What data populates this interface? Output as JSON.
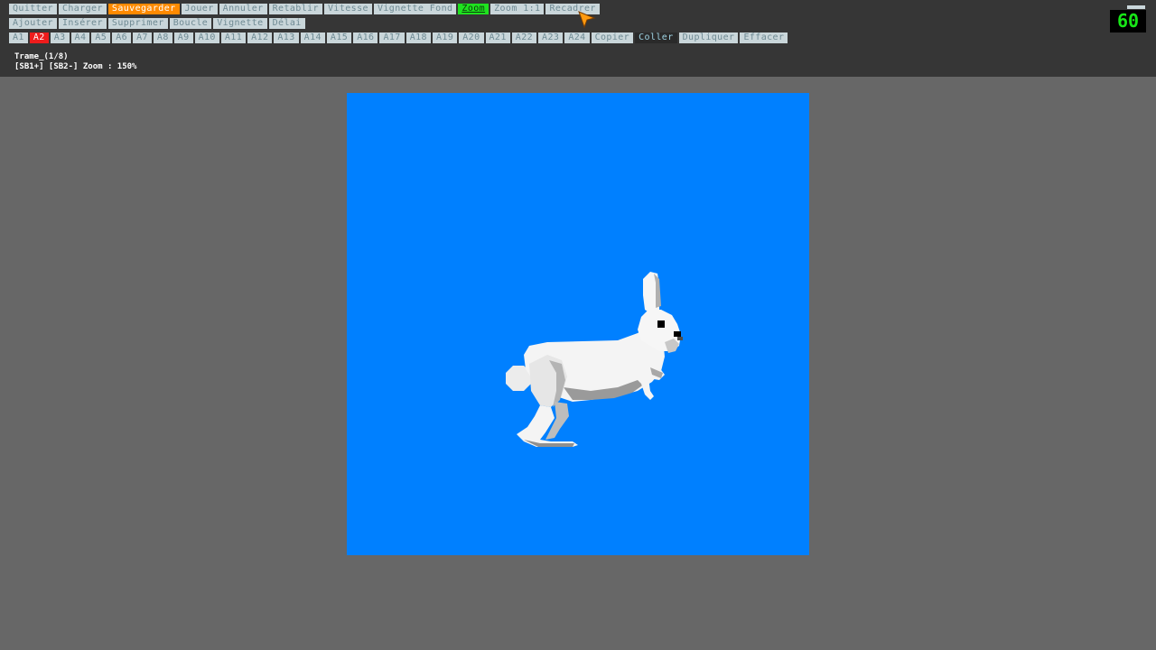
{
  "toolbar": {
    "menu": [
      {
        "label": "Quitter",
        "state": "normal"
      },
      {
        "label": "Charger",
        "state": "normal"
      },
      {
        "label": "Sauvegarder",
        "state": "active"
      },
      {
        "label": "Jouer",
        "state": "normal"
      },
      {
        "label": "Annuler",
        "state": "normal"
      },
      {
        "label": "Retablir",
        "state": "normal"
      },
      {
        "label": "Vitesse",
        "state": "normal"
      },
      {
        "label": "Vignette Fond",
        "state": "normal"
      },
      {
        "label": "Zoom",
        "state": "highlighted"
      },
      {
        "label": "Zoom 1:1",
        "state": "normal"
      },
      {
        "label": "Recadrer",
        "state": "normal"
      }
    ],
    "frame_actions": [
      {
        "label": "Ajouter"
      },
      {
        "label": "Insérer"
      },
      {
        "label": "Supprimer"
      },
      {
        "label": "Boucle"
      },
      {
        "label": "Vignette"
      },
      {
        "label": "Délai"
      }
    ],
    "frames": [
      "A1",
      "A2",
      "A3",
      "A4",
      "A5",
      "A6",
      "A7",
      "A8",
      "A9",
      "A10",
      "A11",
      "A12",
      "A13",
      "A14",
      "A15",
      "A16",
      "A17",
      "A18",
      "A19",
      "A20",
      "A21",
      "A22",
      "A23",
      "A24"
    ],
    "selected_frame": "A2",
    "edit_actions": [
      {
        "label": "Copier",
        "state": "normal"
      },
      {
        "label": "Coller",
        "state": "dark"
      },
      {
        "label": "Dupliquer",
        "state": "normal"
      },
      {
        "label": "Effacer",
        "state": "normal"
      }
    ]
  },
  "status": {
    "frame_line": "Trame_(1/8)",
    "zoom_line": "[SB1+] [SB2-] Zoom : 150%"
  },
  "fps": "60",
  "canvas": {
    "background_color": "#0080ff",
    "sprite": "white-rabbit-icon"
  },
  "colors": {
    "toolbar_bg": "#363636",
    "workspace_bg": "#676767",
    "button_bg": "#c9d6da",
    "button_text": "#6f8a93",
    "active_orange": "#ff8a00",
    "highlight_green": "#1fe21f",
    "selected_red": "#ee1c1c"
  }
}
